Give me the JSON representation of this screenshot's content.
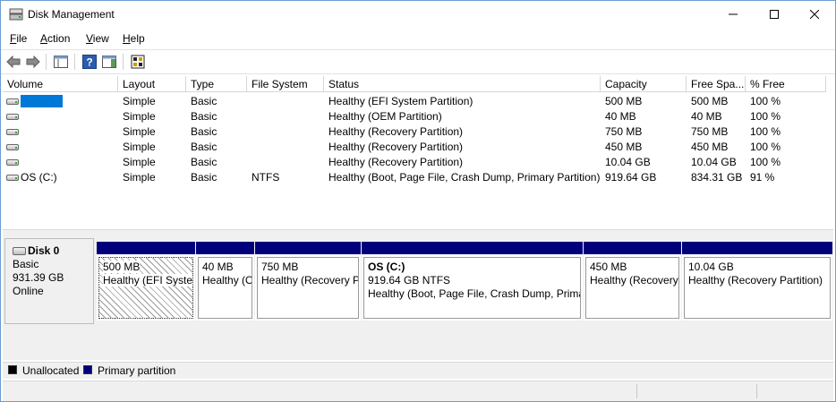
{
  "window": {
    "title": "Disk Management"
  },
  "menu": [
    {
      "label": "File",
      "key": "F",
      "rest": "ile"
    },
    {
      "label": "Action",
      "key": "A",
      "rest": "ction"
    },
    {
      "label": "View",
      "key": "V",
      "rest": "iew"
    },
    {
      "label": "Help",
      "key": "H",
      "rest": "elp"
    }
  ],
  "toolbar": [
    "back-icon",
    "forward-icon",
    "show-hide-console-tree-icon",
    "help-icon",
    "action-pane-icon",
    "properties-icon"
  ],
  "columns": [
    "Volume",
    "Layout",
    "Type",
    "File System",
    "Status",
    "Capacity",
    "Free Spa...",
    "% Free"
  ],
  "volumes": [
    {
      "volume": "",
      "layout": "Simple",
      "type": "Basic",
      "fs": "",
      "status": "Healthy (EFI System Partition)",
      "capacity": "500 MB",
      "free": "500 MB",
      "pct": "100 %"
    },
    {
      "volume": "",
      "layout": "Simple",
      "type": "Basic",
      "fs": "",
      "status": "Healthy (OEM Partition)",
      "capacity": "40 MB",
      "free": "40 MB",
      "pct": "100 %"
    },
    {
      "volume": "",
      "layout": "Simple",
      "type": "Basic",
      "fs": "",
      "status": "Healthy (Recovery Partition)",
      "capacity": "750 MB",
      "free": "750 MB",
      "pct": "100 %"
    },
    {
      "volume": "",
      "layout": "Simple",
      "type": "Basic",
      "fs": "",
      "status": "Healthy (Recovery Partition)",
      "capacity": "450 MB",
      "free": "450 MB",
      "pct": "100 %"
    },
    {
      "volume": "",
      "layout": "Simple",
      "type": "Basic",
      "fs": "",
      "status": "Healthy (Recovery Partition)",
      "capacity": "10.04 GB",
      "free": "10.04 GB",
      "pct": "100 %"
    },
    {
      "volume": "OS (C:)",
      "layout": "Simple",
      "type": "Basic",
      "fs": "NTFS",
      "status": "Healthy (Boot, Page File, Crash Dump, Primary Partition)",
      "capacity": "919.64 GB",
      "free": "834.31 GB",
      "pct": "91 %"
    }
  ],
  "disk": {
    "name": "Disk 0",
    "type": "Basic",
    "size": "931.39 GB",
    "state": "Online"
  },
  "partitions": [
    {
      "name": "",
      "size": "500 MB",
      "status": "Healthy (EFI System Partition)",
      "selected": true
    },
    {
      "name": "",
      "size": "40 MB",
      "status": "Healthy (OEM Partition)",
      "selected": false
    },
    {
      "name": "",
      "size": "750 MB",
      "status": "Healthy (Recovery Partition)",
      "selected": false
    },
    {
      "name": "OS  (C:)",
      "size": "919.64 GB NTFS",
      "status": "Healthy (Boot, Page File, Crash Dump, Primary Partition)",
      "selected": false
    },
    {
      "name": "",
      "size": "450 MB",
      "status": "Healthy (Recovery Partition)",
      "selected": false
    },
    {
      "name": "",
      "size": "10.04 GB",
      "status": "Healthy (Recovery Partition)",
      "selected": false
    }
  ],
  "legend": [
    {
      "label": "Unallocated",
      "color": "#000000"
    },
    {
      "label": "Primary partition",
      "color": "#00007b"
    }
  ]
}
